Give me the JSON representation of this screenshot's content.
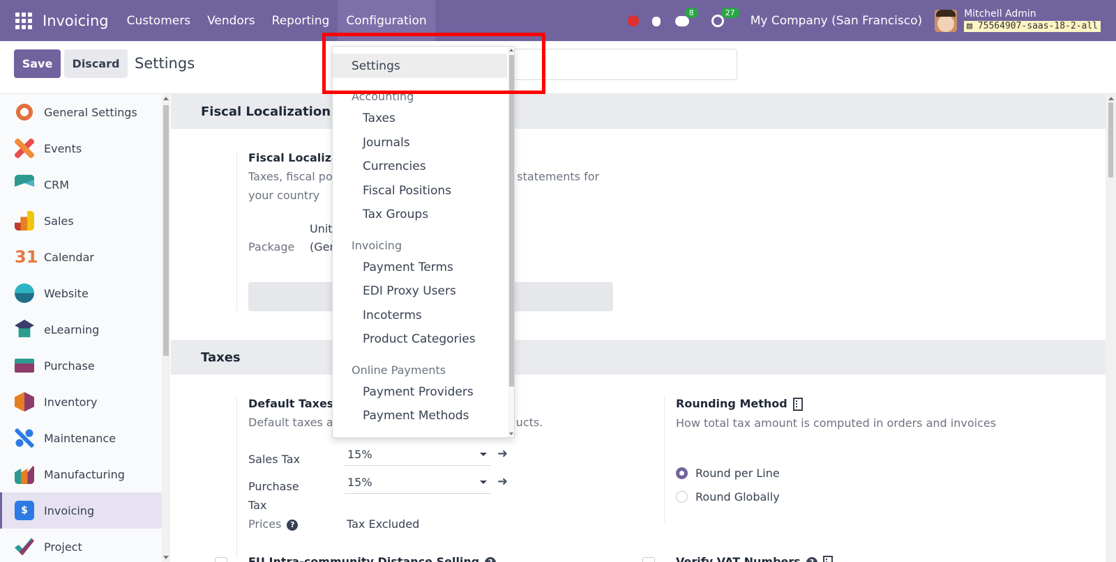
{
  "navbar": {
    "brand": "Invoicing",
    "menu": [
      "Customers",
      "Vendors",
      "Reporting",
      "Configuration"
    ],
    "chat_count": "8",
    "activity_count": "27",
    "company": "My Company (San Francisco)",
    "user_name": "Mitchell Admin",
    "db_name": "75564907-saas-18-2-all",
    "accent": "#71639e"
  },
  "control": {
    "save_label": "Save",
    "discard_label": "Discard",
    "title": "Settings"
  },
  "sidebar": {
    "items": [
      {
        "label": "General Settings",
        "icon": "general-settings-icon"
      },
      {
        "label": "Events",
        "icon": "events-icon"
      },
      {
        "label": "CRM",
        "icon": "crm-icon"
      },
      {
        "label": "Sales",
        "icon": "sales-icon"
      },
      {
        "label": "Calendar",
        "icon": "calendar-icon"
      },
      {
        "label": "Website",
        "icon": "website-icon"
      },
      {
        "label": "eLearning",
        "icon": "elearning-icon"
      },
      {
        "label": "Purchase",
        "icon": "purchase-icon"
      },
      {
        "label": "Inventory",
        "icon": "inventory-icon"
      },
      {
        "label": "Maintenance",
        "icon": "maintenance-icon"
      },
      {
        "label": "Manufacturing",
        "icon": "manufacturing-icon"
      },
      {
        "label": "Invoicing",
        "icon": "invoicing-icon"
      },
      {
        "label": "Project",
        "icon": "project-icon"
      }
    ]
  },
  "main": {
    "fiscal": {
      "section": "Fiscal Localization",
      "title": "Fiscal Localiza",
      "desc_left": "Taxes, fiscal po",
      "desc_right": "l statements for",
      "desc_line2": "your country",
      "package_label": "Package",
      "package_value_1": "Unit",
      "package_value_2": "(Ger"
    },
    "taxes": {
      "section": "Taxes",
      "default_title": "Default Taxes",
      "default_desc_left": "Default taxes a",
      "default_desc_right": "ucts.",
      "sales_tax_label": "Sales Tax",
      "sales_tax_value": "15%",
      "purchase_tax_label_1": "Purchase",
      "purchase_tax_label_2": "Tax",
      "purchase_tax_value": "15%",
      "prices_label": "Prices",
      "prices_value": "Tax Excluded",
      "rounding_title": "Rounding Method",
      "rounding_desc": "How total tax amount is computed in orders and invoices",
      "round_per_line": "Round per Line",
      "round_globally": "Round Globally",
      "eu_title": "EU Intra-community Distance Selling",
      "vat_title": "Verify VAT Numbers"
    }
  },
  "dropdown": {
    "settings": "Settings",
    "accounting_header": "Accounting",
    "accounting": [
      "Taxes",
      "Journals",
      "Currencies",
      "Fiscal Positions",
      "Tax Groups"
    ],
    "invoicing_header": "Invoicing",
    "invoicing": [
      "Payment Terms",
      "EDI Proxy Users",
      "Incoterms",
      "Product Categories"
    ],
    "online_header": "Online Payments",
    "online": [
      "Payment Providers",
      "Payment Methods"
    ]
  }
}
